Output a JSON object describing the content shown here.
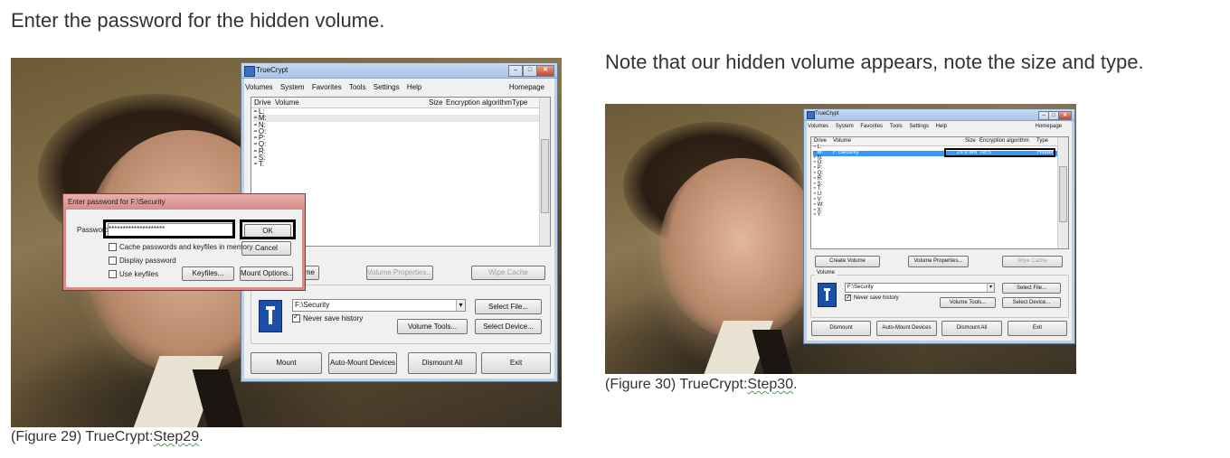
{
  "left": {
    "heading": "Enter the password for the hidden volume.",
    "caption_prefix": "(Figure 29) TrueCrypt:",
    "caption_link": "Step29",
    "caption_suffix": ".",
    "window": {
      "title": "TrueCrypt",
      "menu": [
        "Volumes",
        "System",
        "Favorites",
        "Tools",
        "Settings",
        "Help"
      ],
      "homepage": "Homepage",
      "columns": [
        "Drive",
        "Volume",
        "Size",
        "Encryption algorithm",
        "Type"
      ],
      "drives": [
        "L:",
        "M:",
        "N:",
        "O:",
        "P:",
        "Q:",
        "R:",
        "S:",
        "T:"
      ],
      "btn_create_partial": "me",
      "btn_volume_properties": "Volume Properties...",
      "btn_wipe_cache": "Wipe Cache",
      "volume_path": "F:\\Security",
      "never_save_history": "Never save history",
      "btn_select_file": "Select File...",
      "btn_volume_tools": "Volume Tools...",
      "btn_select_device": "Select Device...",
      "btn_mount": "Mount",
      "btn_auto_mount": "Auto-Mount Devices",
      "btn_dismount_all": "Dismount All",
      "btn_exit": "Exit"
    },
    "dialog": {
      "title": "Enter password for F:\\Security",
      "password_label": "Password:",
      "password_value": "********************",
      "ok": "OK",
      "cancel": "Cancel",
      "cache_label": "Cache passwords and keyfiles in memory",
      "display_label": "Display password",
      "keyfiles_label": "Use keyfiles",
      "btn_keyfiles": "Keyfiles...",
      "btn_mount_options": "Mount Options..."
    }
  },
  "right": {
    "heading": "Note that our hidden volume appears, note the size and type.",
    "caption_prefix": "(Figure 30) TrueCrypt:",
    "caption_link": "Step30",
    "caption_suffix": ".",
    "window": {
      "title": "TrueCrypt",
      "menu": [
        "Volumes",
        "System",
        "Favorites",
        "Tools",
        "Settings",
        "Help"
      ],
      "homepage": "Homepage",
      "columns": [
        "Drive",
        "Volume",
        "Size",
        "Encryption algorithm",
        "Type"
      ],
      "drives": [
        "L:",
        "M:",
        "N:",
        "O:",
        "P:",
        "Q:",
        "R:",
        "S:",
        "T:",
        "U:",
        "V:",
        "W:",
        "X:",
        "Y:"
      ],
      "mounted": {
        "drive": "M:",
        "volume": "F:\\Security",
        "size": "29.9 MB",
        "algorithm": "AES",
        "type": "Hidden"
      },
      "btn_create_volume": "Create Volume",
      "btn_volume_properties": "Volume Properties...",
      "btn_wipe_cache": "Wipe Cache",
      "group_label": "Volume",
      "volume_path": "F:\\Security",
      "never_save_history": "Never save history",
      "btn_select_file": "Select File...",
      "btn_volume_tools": "Volume Tools...",
      "btn_select_device": "Select Device...",
      "btn_dismount": "Dismount",
      "btn_auto_mount": "Auto-Mount Devices",
      "btn_dismount_all": "Dismount All",
      "btn_exit": "Exit"
    }
  }
}
